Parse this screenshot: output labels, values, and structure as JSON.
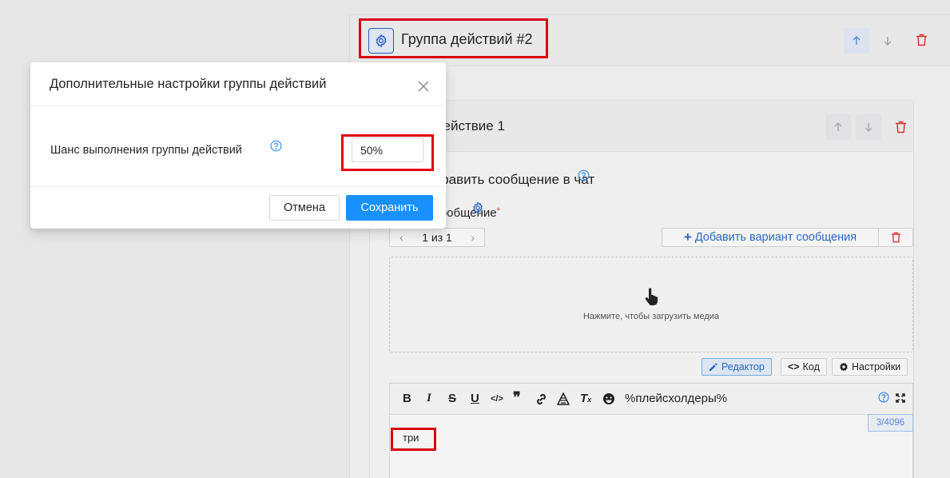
{
  "group": {
    "title": "Группа действий #2"
  },
  "action": {
    "title": "Действие 1"
  },
  "send_message": {
    "title": "Отправить сообщение в чат",
    "message_label": "Сообщение",
    "pager": "1 из 1",
    "add_variant_label": "Добавить вариант сообщения",
    "upload_hint": "Нажмите, чтобы загрузить медиа"
  },
  "editor": {
    "modes": {
      "editor_label": "Редактор",
      "code_label": "Код",
      "settings_label": "Настройки"
    },
    "placeholders_label": "%плейсхолдеры%",
    "counter": "3/4096",
    "content": "три",
    "toolbar_glyphs": {
      "bold": "B",
      "italic": "I",
      "strike": "S",
      "underline": "U",
      "code": "</>",
      "quote": "❞"
    }
  },
  "modal": {
    "title": "Дополнительные настройки группы действий",
    "field_label": "Шанс выполнения группы действий",
    "field_value": "50%",
    "cancel_label": "Отмена",
    "save_label": "Сохранить"
  },
  "colors": {
    "primary": "#1890ff",
    "link": "#2d6ccb",
    "danger": "#e53935",
    "highlight": "#e3000f"
  }
}
